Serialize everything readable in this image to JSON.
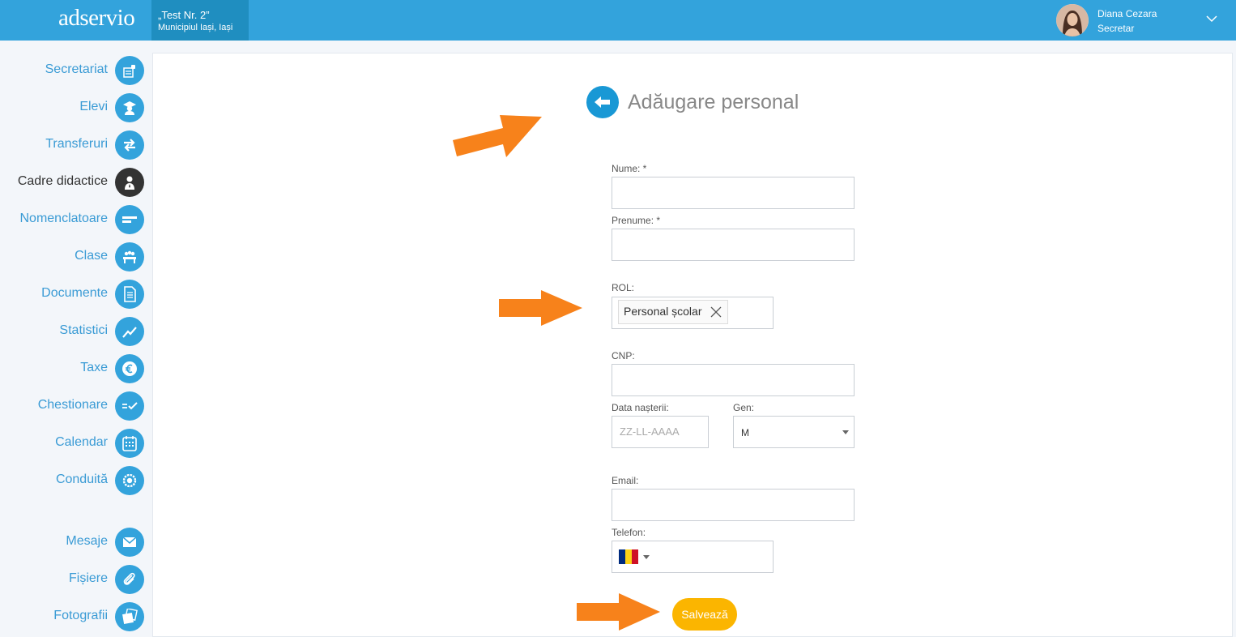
{
  "header": {
    "logo": "adservio",
    "school_name": "„Test Nr. 2”",
    "school_location": "Municipiul Iași, Iași",
    "user_name": "Diana Cezara",
    "user_role": "Secretar"
  },
  "sidebar": {
    "items": [
      {
        "label": "Secretariat",
        "icon": "secretariat-icon"
      },
      {
        "label": "Elevi",
        "icon": "students-icon"
      },
      {
        "label": "Transferuri",
        "icon": "transfer-icon"
      },
      {
        "label": "Cadre didactice",
        "icon": "teacher-icon",
        "active": true
      },
      {
        "label": "Nomenclatoare",
        "icon": "nomenclature-icon"
      },
      {
        "label": "Clase",
        "icon": "classes-icon"
      },
      {
        "label": "Documente",
        "icon": "document-icon"
      },
      {
        "label": "Statistici",
        "icon": "statistics-icon"
      },
      {
        "label": "Taxe",
        "icon": "euro-icon"
      },
      {
        "label": "Chestionare",
        "icon": "questionnaire-icon"
      },
      {
        "label": "Calendar",
        "icon": "calendar-icon"
      },
      {
        "label": "Conduită",
        "icon": "conduct-icon"
      },
      {
        "label": "Mesaje",
        "icon": "mail-icon"
      },
      {
        "label": "Fișiere",
        "icon": "paperclip-icon"
      },
      {
        "label": "Fotografii",
        "icon": "photos-icon"
      }
    ]
  },
  "form": {
    "title": "Adăugare personal",
    "nume_label": "Nume: *",
    "nume_value": "",
    "prenume_label": "Prenume: *",
    "prenume_value": "",
    "rol_label": "ROL:",
    "rol_selected": "Personal școlar",
    "cnp_label": "CNP:",
    "cnp_value": "",
    "data_label": "Data nașterii:",
    "data_placeholder": "ZZ-LL-AAAA",
    "gen_label": "Gen:",
    "gen_value": "M",
    "email_label": "Email:",
    "email_value": "",
    "telefon_label": "Telefon:",
    "telefon_value": "",
    "save_label": "Salvează"
  },
  "colors": {
    "topbar": "#33a3dc",
    "accent": "#1998d5",
    "save": "#fbb500",
    "arrow": "#f7821b"
  }
}
